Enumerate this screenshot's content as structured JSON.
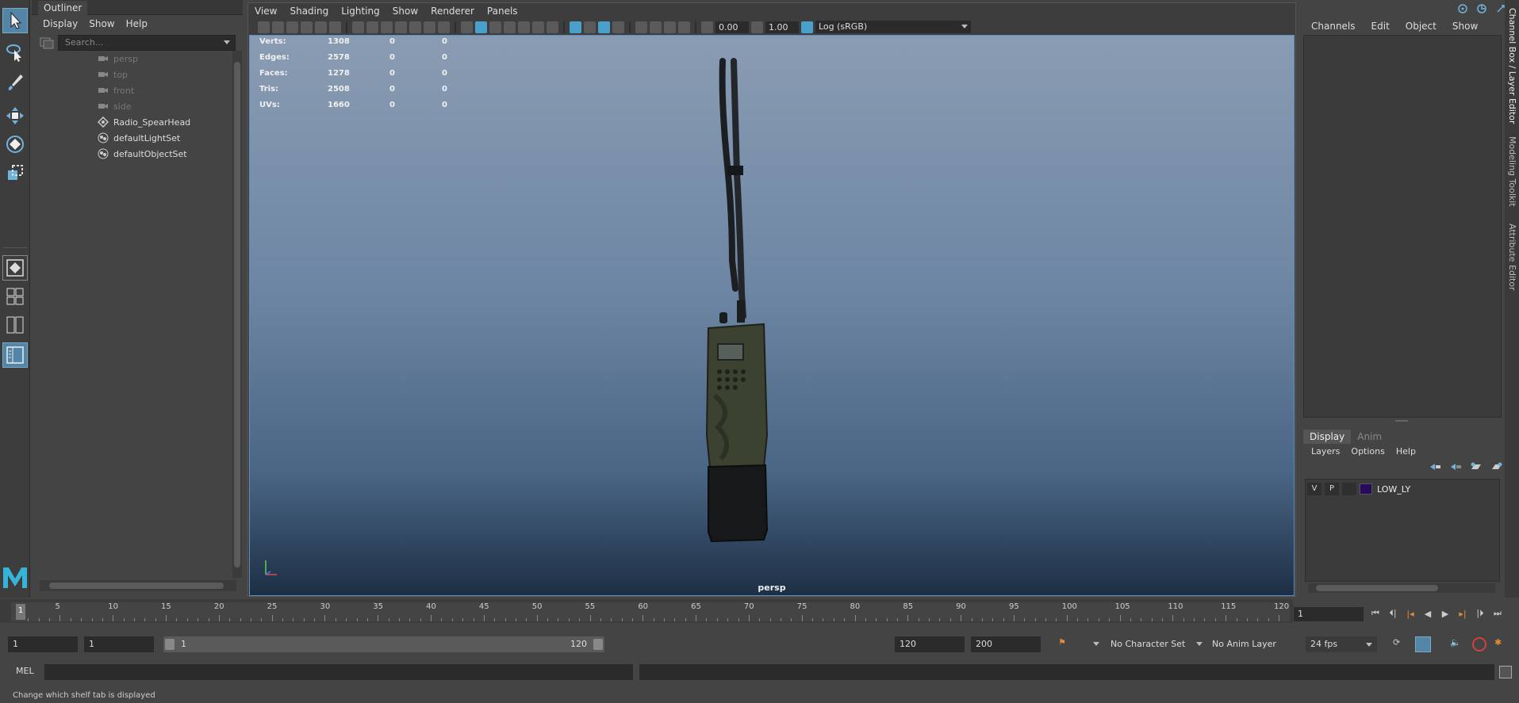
{
  "outliner": {
    "tab": "Outliner",
    "menu": [
      "Display",
      "Show",
      "Help"
    ],
    "search_placeholder": "Search...",
    "items": [
      {
        "label": "persp",
        "type": "camera",
        "dim": true
      },
      {
        "label": "top",
        "type": "camera",
        "dim": true
      },
      {
        "label": "front",
        "type": "camera",
        "dim": true
      },
      {
        "label": "side",
        "type": "camera",
        "dim": true
      },
      {
        "label": "Radio_SpearHead",
        "type": "transform",
        "dim": false
      },
      {
        "label": "defaultLightSet",
        "type": "set",
        "dim": false
      },
      {
        "label": "defaultObjectSet",
        "type": "set",
        "dim": false
      }
    ]
  },
  "viewport": {
    "menu": [
      "View",
      "Shading",
      "Lighting",
      "Show",
      "Renderer",
      "Panels"
    ],
    "exposure": "0.00",
    "gamma": "1.00",
    "color_space": "Log (sRGB)",
    "camera": "persp",
    "hud": [
      {
        "label": "Verts:",
        "v1": "1308",
        "v2": "0",
        "v3": "0"
      },
      {
        "label": "Edges:",
        "v1": "2578",
        "v2": "0",
        "v3": "0"
      },
      {
        "label": "Faces:",
        "v1": "1278",
        "v2": "0",
        "v3": "0"
      },
      {
        "label": "Tris:",
        "v1": "2508",
        "v2": "0",
        "v3": "0"
      },
      {
        "label": "UVs:",
        "v1": "1660",
        "v2": "0",
        "v3": "0"
      }
    ]
  },
  "channel_box": {
    "menu": [
      "Channels",
      "Edit",
      "Object",
      "Show"
    ],
    "layer_tabs": [
      "Display",
      "Anim"
    ],
    "layer_menu": [
      "Layers",
      "Options",
      "Help"
    ],
    "layer": {
      "v": "V",
      "p": "P",
      "name": "LOW_LY",
      "color": "#2a0a5e"
    }
  },
  "side_tabs": [
    "Channel Box / Layer Editor",
    "Modeling Toolkit",
    "Attribute Editor"
  ],
  "timeline": {
    "ticks": [
      5,
      10,
      15,
      20,
      25,
      30,
      35,
      40,
      45,
      50,
      55,
      60,
      65,
      70,
      75,
      80,
      85,
      90,
      95,
      100,
      105,
      110,
      115,
      120
    ],
    "start_tick": "1",
    "current_frame": "1"
  },
  "range": {
    "start": "1",
    "playback_start": "1",
    "slider_start": "1",
    "slider_end": "120",
    "playback_end": "120",
    "end": "200",
    "character_set": "No Character Set",
    "anim_layer": "No Anim Layer",
    "fps": "24 fps"
  },
  "command": {
    "label": "MEL",
    "help": "Change which shelf tab is displayed"
  },
  "colors": {
    "accent": "#5285a6",
    "highlight": "#4aa0cc"
  }
}
